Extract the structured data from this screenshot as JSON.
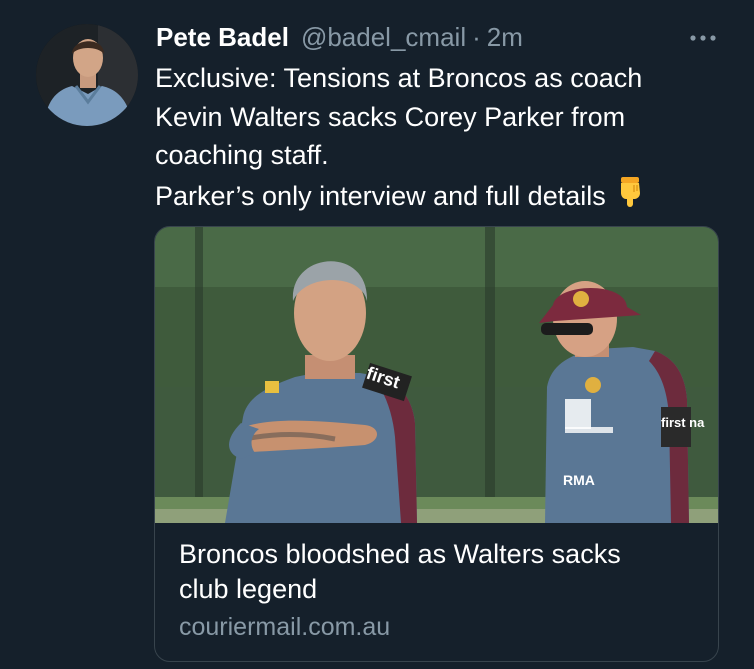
{
  "tweet": {
    "author_name": "Pete Badel",
    "author_handle": "@badel_cmail",
    "separator": "·",
    "time_ago": "2m",
    "text_lines": [
      "Exclusive: Tensions at Broncos as coach",
      "Kevin Walters sacks Corey Parker from",
      "coaching staff.",
      "Parker’s only interview and full details"
    ],
    "emoji_icon": "backhand-index-pointing-down-icon"
  },
  "card": {
    "title_lines": [
      "Broncos bloodshed as Walters sacks",
      "club legend"
    ],
    "domain": "couriermail.com.au",
    "image_jersey_text": {
      "left_chest": "first",
      "right_chest": "first na",
      "right_sponsor": "RMA"
    }
  },
  "colors": {
    "background": "#15202b",
    "text_primary": "#ffffff",
    "text_secondary": "#8899a6",
    "card_border": "#38444d",
    "jersey_blue": "#5a7795",
    "jersey_maroon": "#6d2b3d"
  }
}
